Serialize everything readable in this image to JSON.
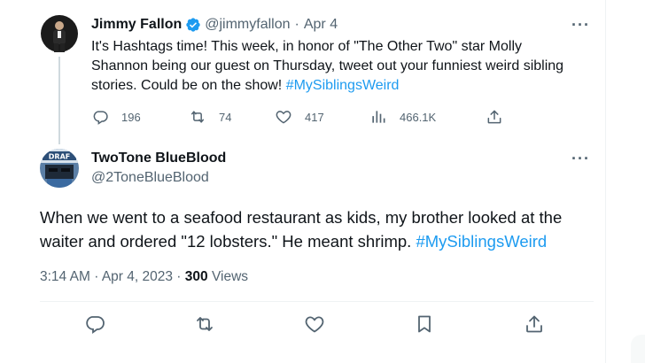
{
  "parent_tweet": {
    "author_name": "Jimmy Fallon",
    "handle": "@jimmyfallon",
    "dot": "·",
    "date": "Apr 4",
    "text_plain": "It's Hashtags time! This week, in honor of \"The Other Two\" star Molly Shannon being our guest on Thursday, tweet out your funniest weird sibling stories. Could be on the show! ",
    "hashtag": "#MySiblingsWeird",
    "stats": {
      "replies": "196",
      "retweets": "74",
      "likes": "417",
      "views": "466.1K"
    }
  },
  "main_tweet": {
    "author_name": "TwoTone BlueBlood",
    "handle": "@2ToneBlueBlood",
    "text_plain": "When we went to a seafood restaurant as kids, my brother looked at the waiter and ordered \"12 lobsters.\" He meant shrimp. ",
    "hashtag": "#MySiblingsWeird",
    "time": "3:14 AM",
    "dot": "·",
    "date": "Apr 4, 2023",
    "views_count": "300",
    "views_label": "Views"
  },
  "icons": {
    "verified": "verified-badge-icon",
    "more": "more-icon",
    "reply": "reply-icon",
    "retweet": "retweet-icon",
    "like": "like-icon",
    "views": "views-icon",
    "share": "share-icon",
    "bookmark": "bookmark-icon"
  },
  "colors": {
    "accent": "#1d9bf0",
    "text": "#0f1419",
    "secondary": "#536471",
    "divider": "#eff3f4"
  }
}
